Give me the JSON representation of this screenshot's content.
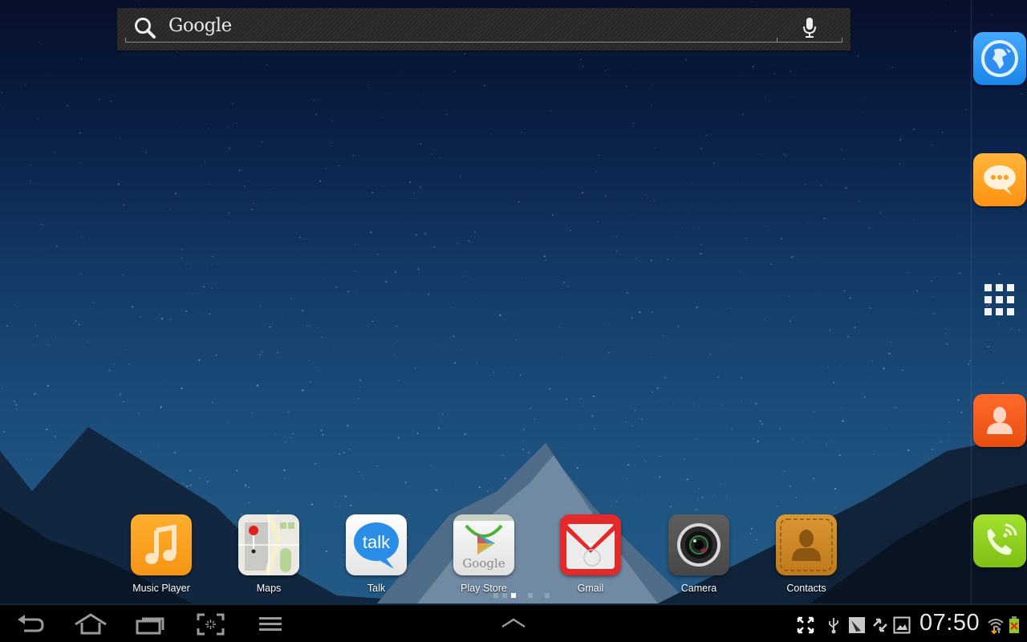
{
  "search_widget": {
    "label": "Google",
    "search_icon": "search-icon",
    "voice_icon": "microphone-icon"
  },
  "right_dock": [
    {
      "name": "browser",
      "icon": "globe-icon",
      "color": "#2b9af3"
    },
    {
      "name": "messaging",
      "icon": "chat-bubble-icon",
      "color": "#ff9f1c"
    },
    {
      "name": "all-apps",
      "icon": "apps-grid-icon",
      "color": "#ffffff"
    },
    {
      "name": "contacts",
      "icon": "person-icon",
      "color": "#f05a1e"
    },
    {
      "name": "phone",
      "icon": "phone-icon",
      "color": "#8ccc1e"
    }
  ],
  "hotseat": {
    "apps": [
      {
        "label": "Music Player",
        "icon": "music-note-icon"
      },
      {
        "label": "Maps",
        "icon": "map-pin-icon"
      },
      {
        "label": "Talk",
        "icon": "talk-bubble-icon"
      },
      {
        "label": "Play Store",
        "icon": "play-store-bag-icon"
      },
      {
        "label": "Gmail",
        "icon": "envelope-icon"
      },
      {
        "label": "Camera",
        "icon": "camera-lens-icon"
      },
      {
        "label": "Contacts",
        "icon": "contact-card-icon"
      }
    ]
  },
  "page_indicator": {
    "total": 5,
    "current": 3
  },
  "navigation_bar": {
    "buttons": [
      "back",
      "home",
      "recent-apps",
      "screenshot",
      "menu"
    ],
    "center_button": "up-arrow",
    "status": {
      "time": "07:50",
      "icons": [
        "fullscreen-icon",
        "usb-icon",
        "debug-icon",
        "sync-icon",
        "gallery-icon",
        "wifi-icon",
        "battery-icon"
      ]
    }
  }
}
